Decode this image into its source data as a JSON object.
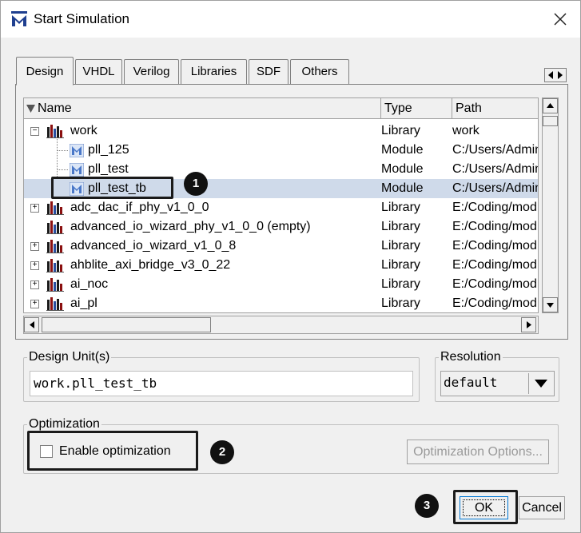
{
  "window": {
    "title": "Start Simulation",
    "close_icon": "close-icon"
  },
  "tabs": [
    {
      "label": "Design",
      "active": true
    },
    {
      "label": "VHDL",
      "active": false
    },
    {
      "label": "Verilog",
      "active": false
    },
    {
      "label": "Libraries",
      "active": false
    },
    {
      "label": "SDF",
      "active": false
    },
    {
      "label": "Others",
      "active": false
    }
  ],
  "tree": {
    "columns": {
      "name": "Name",
      "type": "Type",
      "path": "Path"
    },
    "rows": [
      {
        "name": "work",
        "type": "Library",
        "path": "work",
        "kind": "library",
        "expander": "−",
        "level": 0,
        "selected": false
      },
      {
        "name": "pll_125",
        "type": "Module",
        "path": "C:/Users/Admin",
        "kind": "module",
        "expander": "",
        "level": 1,
        "selected": false
      },
      {
        "name": "pll_test",
        "type": "Module",
        "path": "C:/Users/Admin",
        "kind": "module",
        "expander": "",
        "level": 1,
        "selected": false
      },
      {
        "name": "pll_test_tb",
        "type": "Module",
        "path": "C:/Users/Admin",
        "kind": "module",
        "expander": "",
        "level": 1,
        "selected": true
      },
      {
        "name": "adc_dac_if_phy_v1_0_0",
        "type": "Library",
        "path": "E:/Coding/mod",
        "kind": "library",
        "expander": "+",
        "level": 0,
        "selected": false
      },
      {
        "name": "advanced_io_wizard_phy_v1_0_0  (empty)",
        "type": "Library",
        "path": "E:/Coding/mod",
        "kind": "library",
        "expander": "",
        "level": 0,
        "selected": false
      },
      {
        "name": "advanced_io_wizard_v1_0_8",
        "type": "Library",
        "path": "E:/Coding/mod",
        "kind": "library",
        "expander": "+",
        "level": 0,
        "selected": false
      },
      {
        "name": "ahblite_axi_bridge_v3_0_22",
        "type": "Library",
        "path": "E:/Coding/mod",
        "kind": "library",
        "expander": "+",
        "level": 0,
        "selected": false
      },
      {
        "name": "ai_noc",
        "type": "Library",
        "path": "E:/Coding/mod",
        "kind": "library",
        "expander": "+",
        "level": 0,
        "selected": false
      },
      {
        "name": "ai_pl",
        "type": "Library",
        "path": "E:/Coding/mod",
        "kind": "library",
        "expander": "+",
        "level": 0,
        "selected": false
      }
    ]
  },
  "design_unit": {
    "label": "Design Unit(s)",
    "value": "work.pll_test_tb"
  },
  "resolution": {
    "label": "Resolution",
    "value": "default"
  },
  "optimization": {
    "label": "Optimization",
    "enable_label": "Enable optimization",
    "enabled": false,
    "options_button": "Optimization Options..."
  },
  "buttons": {
    "ok": "OK",
    "cancel": "Cancel"
  },
  "annotations": {
    "badge1": "1",
    "badge2": "2",
    "badge3": "3"
  },
  "colors": {
    "selection": "#cfdaea",
    "annotation": "#111111"
  }
}
